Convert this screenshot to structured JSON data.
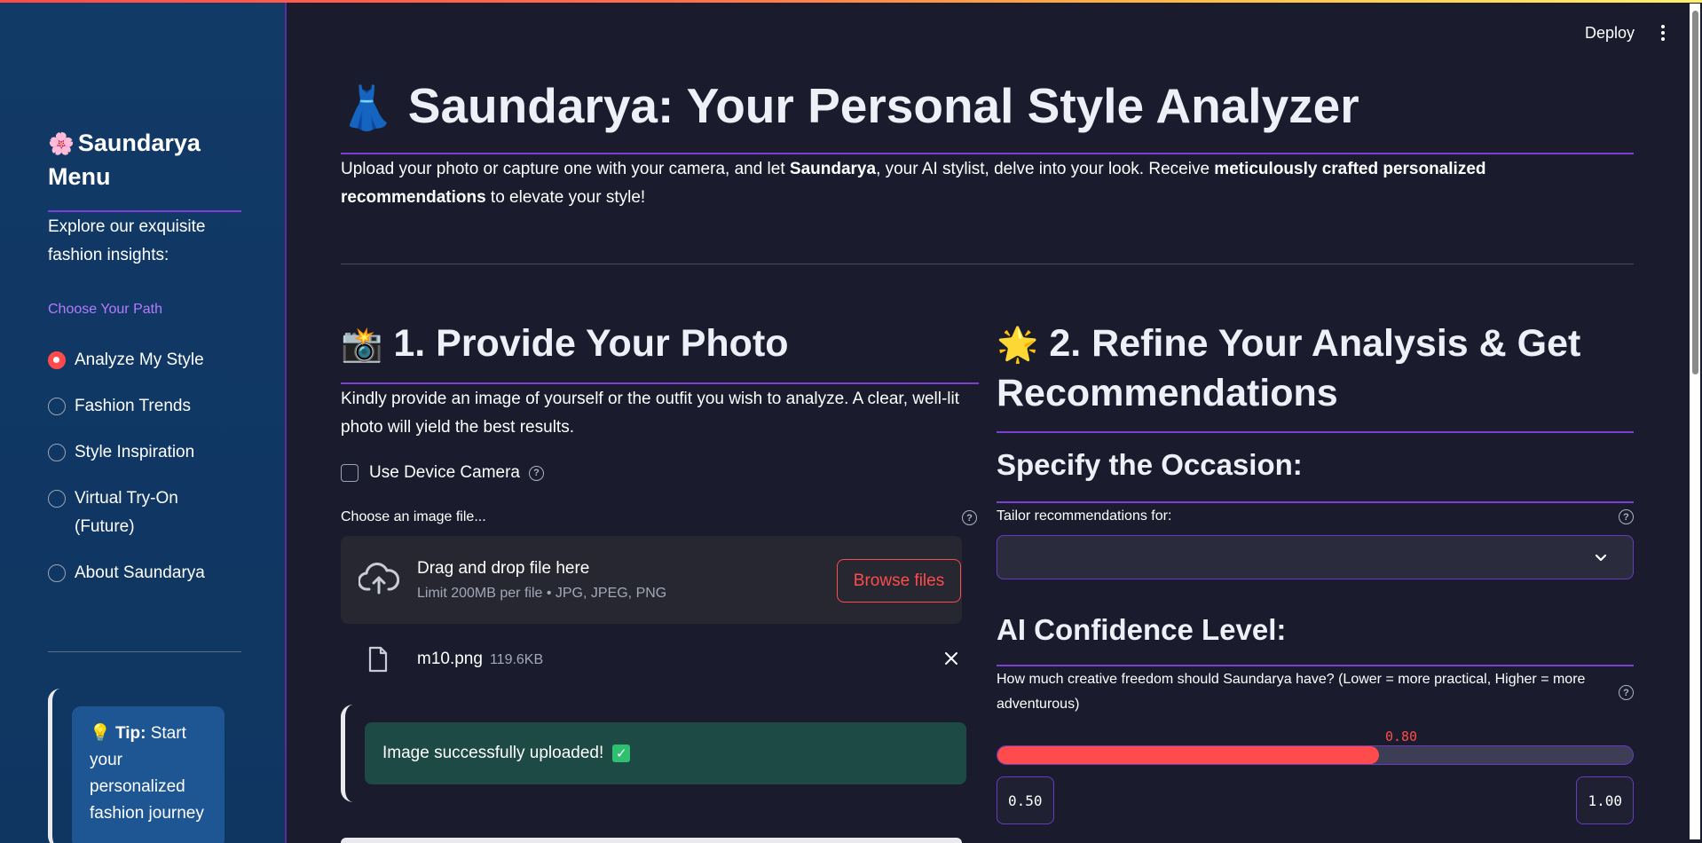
{
  "header": {
    "deploy_label": "Deploy"
  },
  "sidebar": {
    "title_emoji": "🌸",
    "title": "Saundarya Menu",
    "explore_text": "Explore our exquisite fashion insights:",
    "path_label": "Choose Your Path",
    "items": [
      {
        "label": "Analyze My Style",
        "selected": true
      },
      {
        "label": "Fashion Trends",
        "selected": false
      },
      {
        "label": "Style Inspiration",
        "selected": false
      },
      {
        "label": "Virtual Try-On (Future)",
        "selected": false
      },
      {
        "label": "About Saundarya",
        "selected": false
      }
    ],
    "tip_emoji": "💡",
    "tip_bold": "Tip:",
    "tip_text": "Start your personalized fashion journey"
  },
  "main": {
    "title_emoji": "👗",
    "title": "Saundarya: Your Personal Style Analyzer",
    "intro_part1": "Upload your photo or capture one with your camera, and let ",
    "intro_bold1": "Saundarya",
    "intro_part2": ", your AI stylist, delve into your look. Receive ",
    "intro_bold2": "meticulously crafted personalized recommendations",
    "intro_part3": " to elevate your style!"
  },
  "photo_section": {
    "emoji": "📸",
    "title": "1. Provide Your Photo",
    "description": "Kindly provide an image of yourself or the outfit you wish to analyze. A clear, well-lit photo will yield the best results.",
    "camera_label": "Use Device Camera",
    "choose_label": "Choose an image file...",
    "drop_title": "Drag and drop file here",
    "drop_limit": "Limit 200MB per file • JPG, JPEG, PNG",
    "browse_label": "Browse files",
    "file_name": "m10.png",
    "file_size": "119.6KB",
    "success_text": "Image successfully uploaded!"
  },
  "analysis_section": {
    "emoji": "🌟",
    "title": "2. Refine Your Analysis & Get Recommendations",
    "occasion_title": "Specify the Occasion:",
    "tailor_label": "Tailor recommendations for:",
    "confidence_title": "AI Confidence Level:",
    "confidence_label": "How much creative freedom should Saundarya have? (Lower = more practical, Higher = more adventurous)",
    "slider_value": "0.80",
    "slider_fraction": 0.6,
    "slider_min": "0.50",
    "slider_max": "1.00"
  },
  "colors": {
    "accent": "#ff4b4b",
    "purple": "#7b3fd3",
    "sidebar_bg": "#123a66",
    "main_bg": "#1a1c2e",
    "success_bg": "#1d4a44"
  }
}
